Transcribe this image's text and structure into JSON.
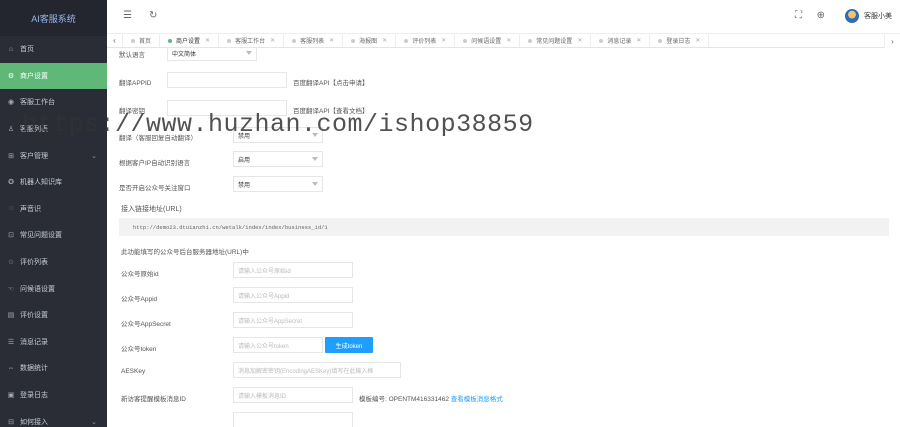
{
  "app": {
    "title": "AI客服系统"
  },
  "sidebar": {
    "items": [
      {
        "icon": "⌂",
        "label": "首页",
        "active": false,
        "arrow": ""
      },
      {
        "icon": "⚙",
        "label": "商户设置",
        "active": true,
        "arrow": ""
      },
      {
        "icon": "◉",
        "label": "客服工作台",
        "active": false,
        "arrow": ""
      },
      {
        "icon": "♙",
        "label": "客服列表",
        "active": false,
        "arrow": ""
      },
      {
        "icon": "⊞",
        "label": "客户管理",
        "active": false,
        "arrow": "⌄"
      },
      {
        "icon": "✪",
        "label": "机器人知识库",
        "active": false,
        "arrow": ""
      },
      {
        "icon": "◌",
        "label": "声音识",
        "active": false,
        "arrow": ""
      },
      {
        "icon": "⊡",
        "label": "常见问题设置",
        "active": false,
        "arrow": ""
      },
      {
        "icon": "☆",
        "label": "评价列表",
        "active": false,
        "arrow": ""
      },
      {
        "icon": "☜",
        "label": "问候语设置",
        "active": false,
        "arrow": ""
      },
      {
        "icon": "▤",
        "label": "评价设置",
        "active": false,
        "arrow": ""
      },
      {
        "icon": "☰",
        "label": "消息记录",
        "active": false,
        "arrow": ""
      },
      {
        "icon": "⇔",
        "label": "数据统计",
        "active": false,
        "arrow": ""
      },
      {
        "icon": "▣",
        "label": "登录日志",
        "active": false,
        "arrow": ""
      },
      {
        "icon": "⊟",
        "label": "如何接入",
        "active": false,
        "arrow": "⌄"
      }
    ]
  },
  "topbar": {
    "menu_icon": "☰",
    "refresh_icon": "↻",
    "fullscreen_icon": "⛶",
    "globe_icon": "⊕",
    "username": "客服小美"
  },
  "tabs": {
    "left_arrow": "‹",
    "right_arrow": "›",
    "close": "✕",
    "items": [
      {
        "label": "首页",
        "active": false
      },
      {
        "label": "商户设置",
        "active": true
      },
      {
        "label": "客服工作台",
        "active": false
      },
      {
        "label": "客服列表",
        "active": false
      },
      {
        "label": "海报图",
        "active": false
      },
      {
        "label": "评价列表",
        "active": false
      },
      {
        "label": "问候语设置",
        "active": false
      },
      {
        "label": "常见问题设置",
        "active": false
      },
      {
        "label": "消息记录",
        "active": false
      },
      {
        "label": "登录日志",
        "active": false
      }
    ]
  },
  "form": {
    "default_lang_label": "默认语言",
    "default_lang_value": "中文简体",
    "translate_appid_label": "翻译APPID",
    "translate_appid_hint": "百度翻译API【点击申请】",
    "translate_key_label": "翻译密钥",
    "translate_key_hint": "百度翻译API【查看文档】",
    "auto_translate_label": "翻译（客服回复自动翻译）",
    "auto_translate_value": "禁用",
    "auto_lang_label": "根据客户IP自动识别语言",
    "auto_lang_value": "启用",
    "follow_label": "是否开启公众号关注窗口",
    "follow_value": "禁用",
    "url_label": "接入链接地址(URL)",
    "url_value": "http://demo23.dtuianzhi.cn/wetalk/index/index/business_id/1",
    "notice_text": "此功能填写的公众号后台服务器地址(URL)中",
    "mp_id_label": "公众号原始id",
    "mp_id_placeholder": "请输入公众号原始id",
    "appid_label": "公众号Appid",
    "appid_placeholder": "请输入公众号Appid",
    "appsecret_label": "公众号AppSecret",
    "appsecret_placeholder": "请输入公众号AppSecret",
    "token_label": "公众号token",
    "token_placeholder": "请输入公众号token",
    "token_button": "生成token",
    "aeskey_label": "AESKey",
    "aeskey_placeholder": "消息加解密密钥(EncodingAESKey)填写在此输入框",
    "tpl_label": "新访客提醒模板消息ID",
    "tpl_placeholder": "请输入模板消息ID",
    "tpl_code_text": "模板编号: OPENTM416331462",
    "tpl_link": "查看模板消息格式"
  },
  "watermark": "https://www.huzhan.com/ishop38859"
}
